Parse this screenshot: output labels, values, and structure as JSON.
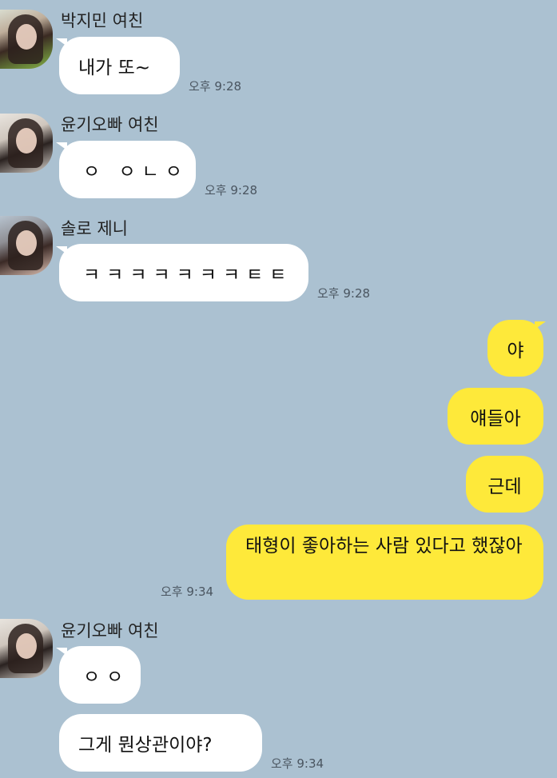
{
  "messages": [
    {
      "sender": "박지민 여친",
      "avatar": "avatar-photo",
      "texts": [
        "내가 또~"
      ],
      "time": "오후 9:28"
    },
    {
      "sender": "윤기오빠 여친",
      "avatar": "avatar-photo",
      "texts": [
        "ㅇ ㅇㄴㅇ"
      ],
      "time": "오후 9:28"
    },
    {
      "sender": "솔로 제니",
      "avatar": "avatar-photo",
      "texts": [
        "ㅋㅋㅋㅋㅋㅋㅋㅌㅌ"
      ],
      "time": "오후 9:28"
    },
    {
      "sender": "me",
      "texts": [
        "야",
        "얘들아",
        "근데",
        "태형이 좋아하는 사람 있다고 했잖아"
      ],
      "time": "오후 9:34"
    },
    {
      "sender": "윤기오빠 여친",
      "avatar": "avatar-photo",
      "texts": [
        "ㅇㅇ",
        "그게 뭔상관이야?"
      ],
      "time": "오후 9:34"
    }
  ],
  "colors": {
    "background": "#abc1d1",
    "incoming_bubble": "#ffffff",
    "outgoing_bubble": "#fee93a"
  }
}
